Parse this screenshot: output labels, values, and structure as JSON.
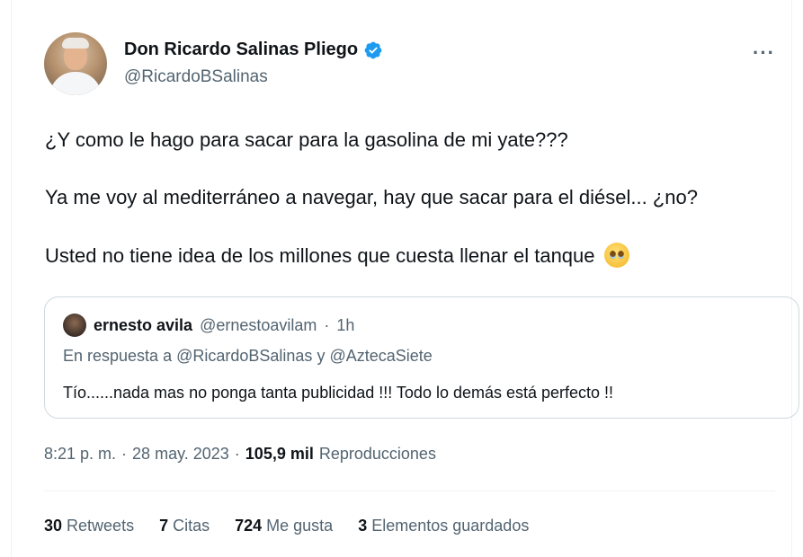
{
  "tweet": {
    "author": {
      "display_name": "Don Ricardo Salinas Pliego",
      "handle": "@RicardoBSalinas",
      "verified": true
    },
    "more_icon": "···",
    "text_lines": [
      "¿Y como le hago para sacar para la gasolina de mi yate???",
      "Ya me voy al mediterráneo a navegar, hay que sacar para el diésel... ¿no?",
      "Usted no tiene idea de los millones que cuesta llenar el tanque"
    ],
    "quoted": {
      "display_name": "ernesto avila",
      "handle": "@ernestoavilam",
      "separator": "·",
      "time": "1h",
      "reply_prefix": "En respuesta a",
      "reply_mention_1": "@RicardoBSalinas",
      "reply_joiner": "y",
      "reply_mention_2": "@AztecaSiete",
      "text": "Tío......nada mas no ponga  tanta publicidad !!! Todo lo demás está perfecto !!"
    },
    "meta": {
      "time": "8:21 p. m.",
      "dot1": "·",
      "date": "28 may. 2023",
      "dot2": "·",
      "views_count": "105,9 mil",
      "views_label": "Reproducciones"
    },
    "stats": [
      {
        "count": "30",
        "label": "Retweets"
      },
      {
        "count": "7",
        "label": "Citas"
      },
      {
        "count": "724",
        "label": "Me gusta"
      },
      {
        "count": "3",
        "label": "Elementos guardados"
      }
    ],
    "colors": {
      "text": "#0f1419",
      "secondary": "#536471",
      "border": "#cfd9de",
      "verified": "#1d9bf0"
    },
    "icons": {
      "verified": "verified-badge-icon",
      "more": "more-options-icon",
      "emoji": "pleading-face-emoji"
    }
  }
}
